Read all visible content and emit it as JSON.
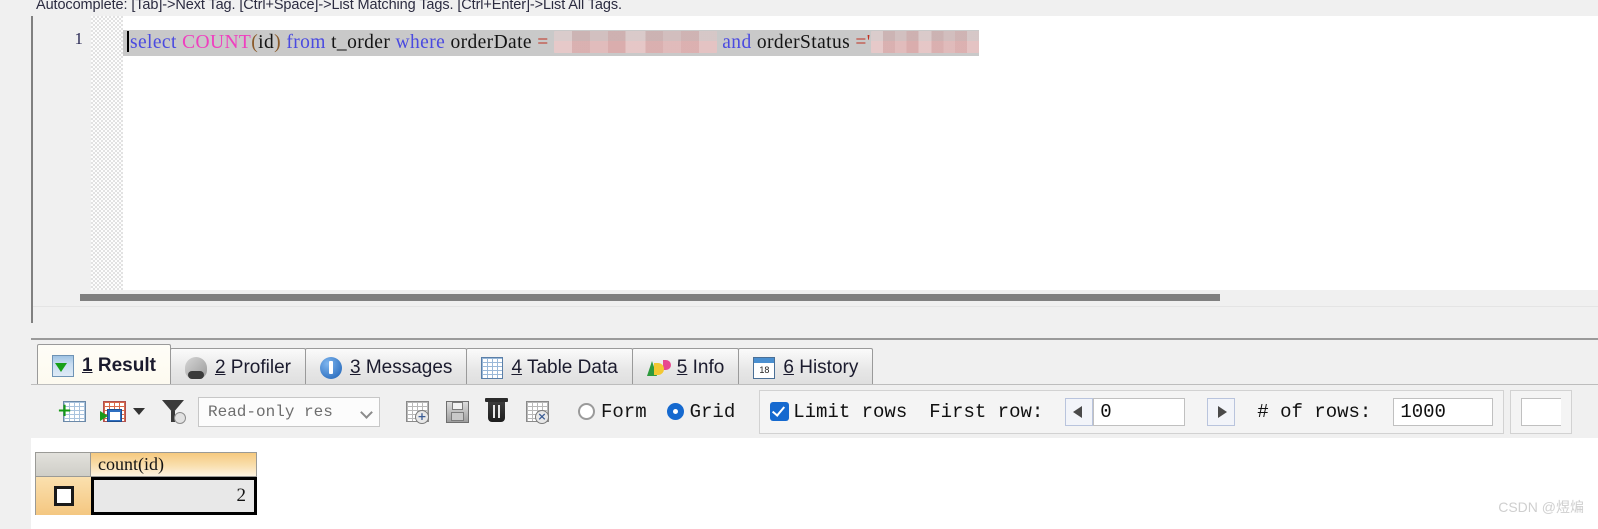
{
  "editor": {
    "autocomplete_hint": "Autocomplete: [Tab]->Next Tag. [Ctrl+Space]->List Matching Tags. [Ctrl+Enter]->List All Tags.",
    "line_number": "1",
    "sql": {
      "full_text": "select COUNT(id) from t_order where orderDate = [redacted] and orderStatus ='[redacted]",
      "tokens": {
        "select": "select",
        "count": "COUNT",
        "open_paren": "(",
        "id": "id",
        "close_paren": ")",
        "from": "from",
        "table": "t_order",
        "where": "where",
        "col_date": "orderDate",
        "eq1": "=",
        "and": "and",
        "col_status": "orderStatus",
        "eq2": "=",
        "quote": "'"
      }
    },
    "colors": {
      "keyword": "#4a4ae0",
      "function": "#ef3fbf",
      "paren": "#8a5a2a",
      "identifier": "#141414",
      "selection": "#c9c9c9",
      "redaction": "#d9a8a8"
    }
  },
  "tabs": [
    {
      "num": "1",
      "label": " Result",
      "icon": "result-grid-icon",
      "active": true
    },
    {
      "num": "2",
      "label": " Profiler",
      "icon": "profiler-icon",
      "active": false
    },
    {
      "num": "3",
      "label": " Messages",
      "icon": "messages-info-icon",
      "active": false
    },
    {
      "num": "4",
      "label": " Table Data",
      "icon": "table-data-icon",
      "active": false
    },
    {
      "num": "5",
      "label": " Info",
      "icon": "info-chart-icon",
      "active": false
    },
    {
      "num": "6",
      "label": " History",
      "icon": "calendar-icon",
      "active": false
    }
  ],
  "toolbar": {
    "icons": [
      "add-record-icon",
      "apply-changes-icon",
      "filter-wizard-icon",
      "duplicate-record-icon",
      "save-record-icon",
      "delete-record-icon",
      "revert-record-icon"
    ],
    "mode_combo": {
      "value": "Read-only res",
      "chevron": "chevron-down-icon"
    },
    "view_modes": [
      {
        "label": "Form",
        "selected": false
      },
      {
        "label": "Grid",
        "selected": true
      }
    ],
    "limit_rows": {
      "checkbox_label": "Limit rows",
      "checked": true,
      "first_row_label": "First row:",
      "first_row_value": "0",
      "num_rows_label": "# of rows:",
      "num_rows_value": "1000",
      "prev_icon": "arrow-left-icon",
      "next_icon": "arrow-right-icon"
    },
    "accent_color": "#1569cf"
  },
  "result_grid": {
    "columns": [
      "count(id)"
    ],
    "rows": [
      {
        "selector": "row-selector-box",
        "values": [
          "2"
        ]
      }
    ]
  },
  "watermark": "CSDN @煜煸"
}
